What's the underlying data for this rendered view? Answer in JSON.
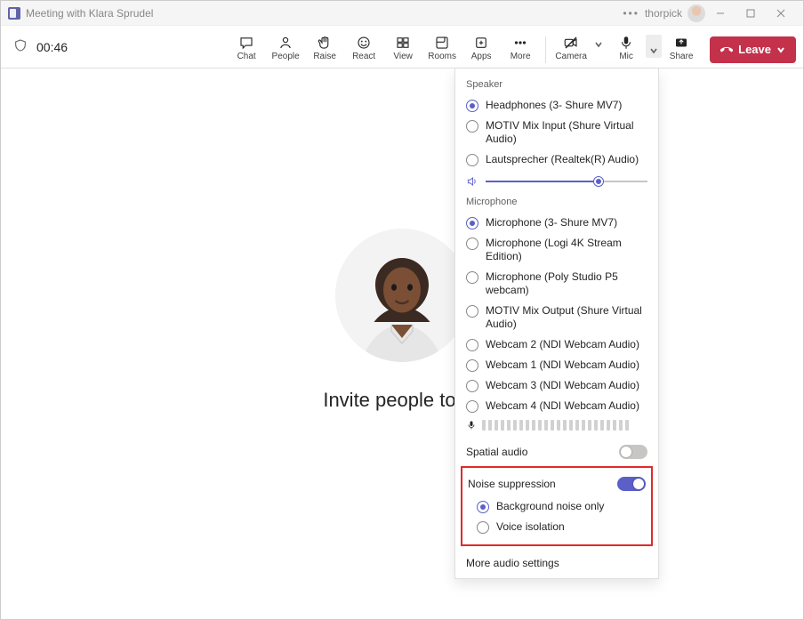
{
  "titlebar": {
    "title": "Meeting with Klara Sprudel",
    "username": "thorpick"
  },
  "toolbar": {
    "time": "00:46",
    "chat": "Chat",
    "people": "People",
    "raise": "Raise",
    "react": "React",
    "view": "View",
    "rooms": "Rooms",
    "apps": "Apps",
    "more": "More",
    "camera": "Camera",
    "mic": "Mic",
    "share": "Share",
    "leave": "Leave"
  },
  "main": {
    "invite_text": "Invite people to joi"
  },
  "panel": {
    "speaker_title": "Speaker",
    "speakers": [
      "Headphones (3- Shure MV7)",
      "MOTIV Mix Input (Shure Virtual Audio)",
      "Lautsprecher (Realtek(R) Audio)"
    ],
    "mic_title": "Microphone",
    "mics": [
      "Microphone (3- Shure MV7)",
      "Microphone (Logi 4K Stream Edition)",
      "Microphone (Poly Studio P5 webcam)",
      "MOTIV Mix Output (Shure Virtual Audio)",
      "Webcam 2 (NDI Webcam Audio)",
      "Webcam 1 (NDI Webcam Audio)",
      "Webcam 3 (NDI Webcam Audio)",
      "Webcam 4 (NDI Webcam Audio)"
    ],
    "spatial": "Spatial audio",
    "noise": "Noise suppression",
    "noise_opts": [
      "Background noise only",
      "Voice isolation"
    ],
    "more_link": "More audio settings"
  }
}
